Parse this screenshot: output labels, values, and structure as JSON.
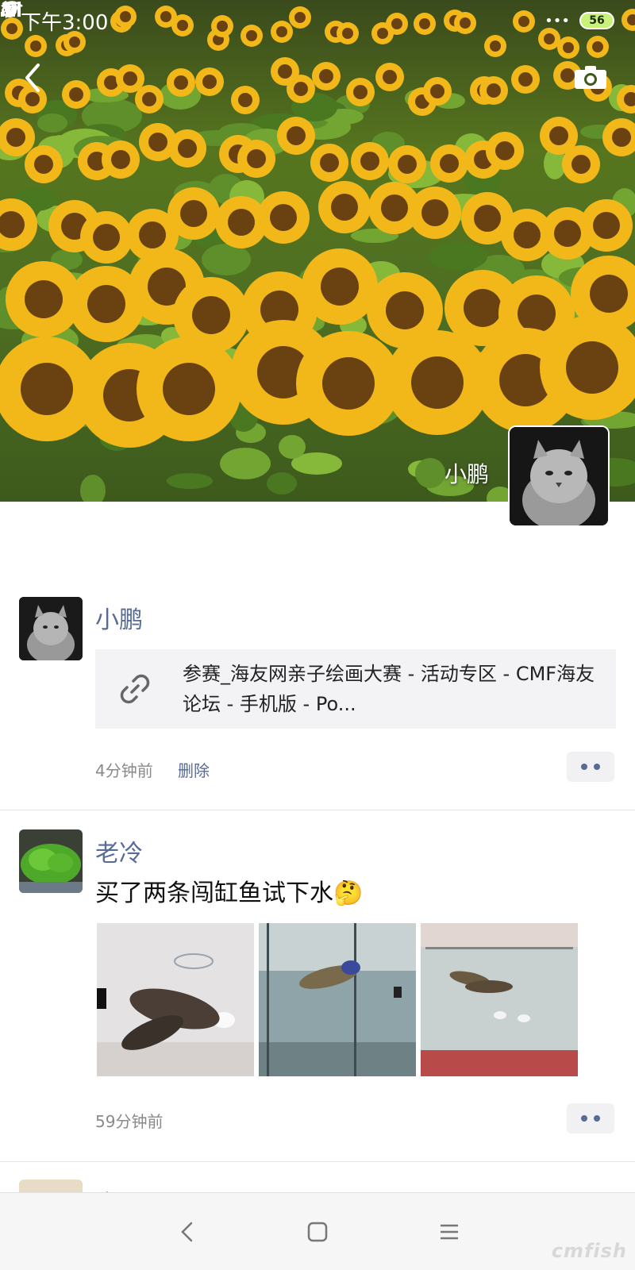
{
  "status_bar": {
    "time": "下午3:00",
    "dots": "•••",
    "battery": "56"
  },
  "cover": {
    "owner_name": "小鹏"
  },
  "posts": [
    {
      "author": "小鹏",
      "link_title": "参赛_海友网亲子绘画大赛 - 活动专区 - CMF海友论坛 - 手机版 - Po...",
      "time": "4分钟前",
      "delete_label": "删除"
    },
    {
      "author": "老冷",
      "text": "买了两条闯缸鱼试下水🤔",
      "time": "59分钟前",
      "photos": [
        "fish-photo-1",
        "fish-photo-2",
        "fish-photo-3"
      ]
    },
    {
      "author": "光明"
    }
  ],
  "watermark": "cmfish",
  "icons": {
    "back": "chevron-left-icon",
    "camera": "camera-icon",
    "link": "link-icon",
    "more": "more-dots-icon",
    "nav_back": "nav-back-icon",
    "nav_home": "nav-home-icon",
    "nav_menu": "nav-menu-icon"
  },
  "colors": {
    "author_name": "#576b95",
    "muted_text": "#8a8a8a",
    "link_card_bg": "#f3f3f5"
  }
}
